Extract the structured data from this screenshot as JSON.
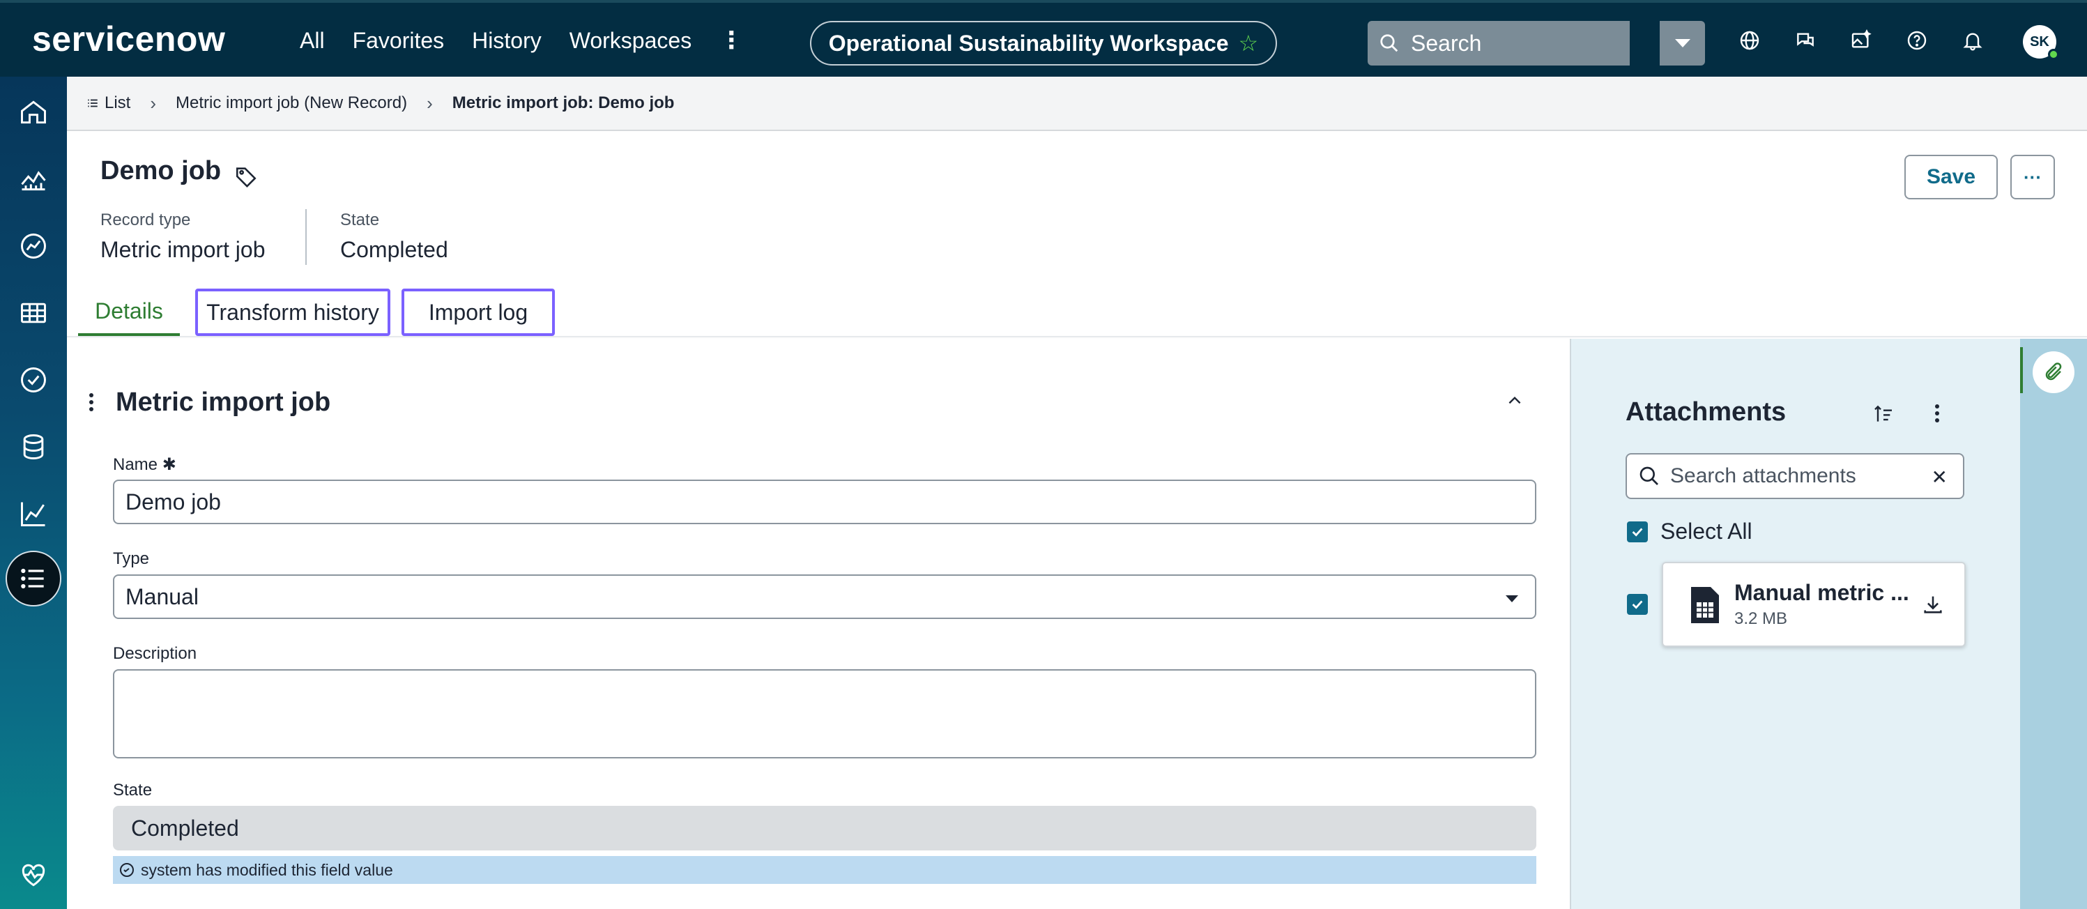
{
  "header": {
    "logo_text": "servicenow",
    "nav": [
      "All",
      "Favorites",
      "History",
      "Workspaces"
    ],
    "workspace_title": "Operational Sustainability Workspace",
    "search_placeholder": "Search",
    "avatar_initials": "SK",
    "accent_color": "#62d84e"
  },
  "breadcrumb": {
    "list_label": "List",
    "items": [
      "Metric import job (New Record)",
      "Metric import job: Demo job"
    ]
  },
  "record": {
    "title": "Demo job",
    "record_type_label": "Record type",
    "record_type_value": "Metric import job",
    "state_label": "State",
    "state_value": "Completed",
    "save_label": "Save",
    "more_label": "···"
  },
  "tabs": {
    "details": "Details",
    "transform_history": "Transform history",
    "import_log": "Import log"
  },
  "form": {
    "section_title": "Metric import job",
    "name_label": "Name",
    "name_value": "Demo job",
    "type_label": "Type",
    "type_value": "Manual",
    "description_label": "Description",
    "description_value": "",
    "state_label": "State",
    "state_value": "Completed",
    "system_note": "system has modified this field value"
  },
  "attachments": {
    "title": "Attachments",
    "search_placeholder": "Search attachments",
    "select_all_label": "Select All",
    "files": [
      {
        "name": "Manual metric ...",
        "size": "3.2 MB"
      }
    ]
  }
}
